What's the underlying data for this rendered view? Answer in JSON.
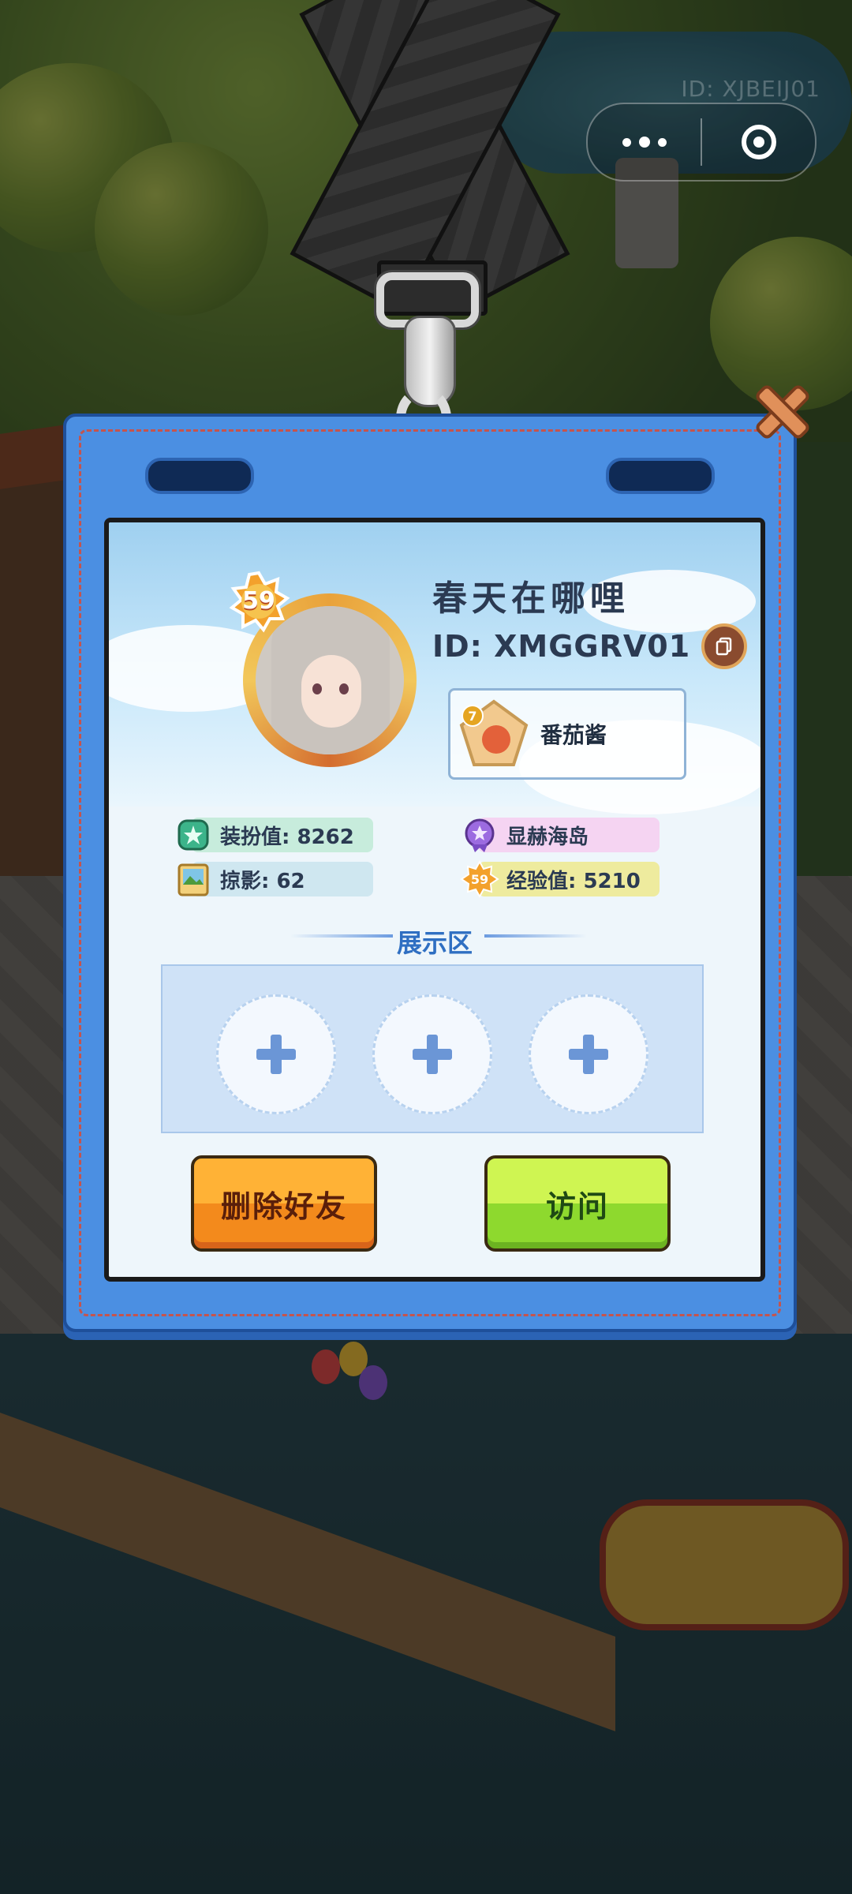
{
  "top_right": {
    "corner_id": "ID: XJBEIJ01"
  },
  "profile": {
    "level": "59",
    "nickname": "春天在哪哩",
    "id_text": "ID: XMGGRV01",
    "pet": {
      "level": "7",
      "name": "番茄酱"
    }
  },
  "stats": [
    {
      "label": "装扮值: 8262",
      "icon": "star-clover-icon",
      "color": "#c7ecdc"
    },
    {
      "label": "掠影: 62",
      "icon": "photo-icon",
      "color": "#cfe7f0"
    },
    {
      "label": "显赫海岛",
      "icon": "purple-medal-icon",
      "color": "#f5d4f2"
    },
    {
      "label": "经验值: 5210",
      "icon": "level-59-badge-icon",
      "level": "59",
      "color": "#eeeb9e"
    }
  ],
  "showcase": {
    "title": "展示区",
    "slots": 3
  },
  "buttons": {
    "delete_friend": "删除好友",
    "visit": "访问"
  },
  "colors": {
    "card_blue": "#4b8fe2",
    "delete_orange": "#f38a1c",
    "visit_green": "#8ed92e",
    "accent_blue": "#2f6fc2"
  }
}
